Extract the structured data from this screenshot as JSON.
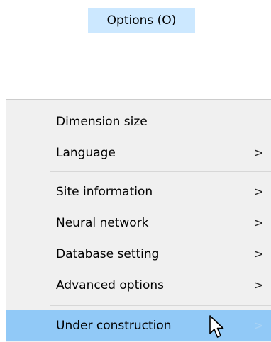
{
  "menubar": {
    "options_label": "Options (O)"
  },
  "menu": {
    "items": [
      {
        "label": "Dimension size",
        "arrow": ""
      },
      {
        "label": "Language",
        "arrow": ">"
      },
      {
        "label": "Site information",
        "arrow": ">"
      },
      {
        "label": "Neural network",
        "arrow": ">"
      },
      {
        "label": "Database setting",
        "arrow": ">"
      },
      {
        "label": "Advanced options",
        "arrow": ">"
      },
      {
        "label": "Under construction",
        "arrow": ">"
      }
    ],
    "highlighted_item": "Under construction"
  },
  "colors": {
    "menubar_highlight": "#cce8ff",
    "menu_background": "#f0f0f0",
    "item_highlight": "#91c9f7"
  },
  "icons": {
    "cursor": "mouse-pointer-icon",
    "submenu": "chevron-right-icon"
  }
}
